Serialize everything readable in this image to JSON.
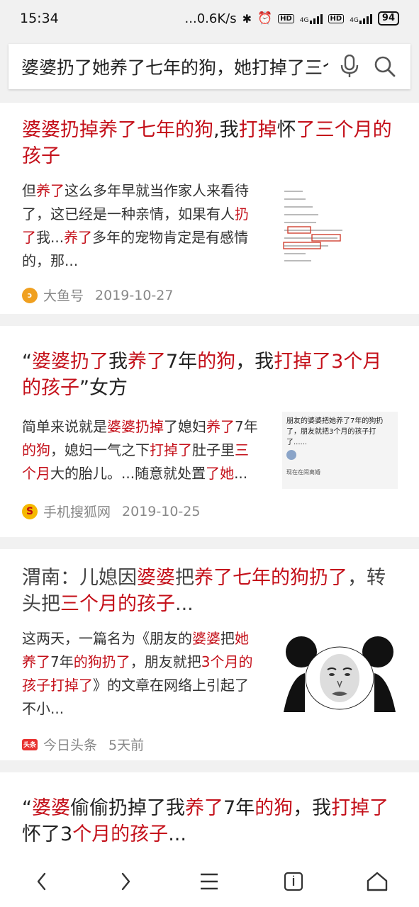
{
  "status": {
    "time": "15:34",
    "net_speed": "...0.6K/s",
    "battery": "94",
    "hd1": "HD",
    "hd2": "HD",
    "net1": "4G",
    "net2": "4G"
  },
  "search": {
    "query": "婆婆扔了她养了七年的狗，她打掉了三个"
  },
  "results": [
    {
      "title_parts": [
        {
          "t": "婆婆扔掉养了七年的狗",
          "h": true
        },
        {
          "t": ",我",
          "h": false
        },
        {
          "t": "打掉",
          "h": true
        },
        {
          "t": "怀",
          "h": false
        },
        {
          "t": "了三个月的",
          "h": true
        },
        {
          "t": "孩子",
          "h": true
        }
      ],
      "snippet_lines": [
        [
          {
            "t": "但",
            "h": false
          },
          {
            "t": "养了",
            "h": true
          },
          {
            "t": "这么多年早就当作家人来看待",
            "h": false
          }
        ],
        [
          {
            "t": "了，这已经是一种亲情，如果有人",
            "h": false
          },
          {
            "t": "扔",
            "h": true
          }
        ],
        [
          {
            "t": "了",
            "h": true
          },
          {
            "t": "我...",
            "h": false
          },
          {
            "t": "养了",
            "h": true
          },
          {
            "t": "多年的宠物肯定是有感情",
            "h": false
          }
        ],
        [
          {
            "t": "的，那...",
            "h": false
          }
        ]
      ],
      "source": "大鱼号",
      "date": "2019-10-27",
      "source_icon_color": "#f0a020"
    },
    {
      "title_parts": [
        {
          "t": "“",
          "h": false
        },
        {
          "t": "婆婆扔了",
          "h": true
        },
        {
          "t": "我",
          "h": false
        },
        {
          "t": "养了",
          "h": true
        },
        {
          "t": "7年",
          "h": false
        },
        {
          "t": "的狗",
          "h": true
        },
        {
          "t": "，我",
          "h": false
        },
        {
          "t": "打掉了3个月的",
          "h": true
        },
        {
          "t": "孩子",
          "h": true
        },
        {
          "t": "”女方",
          "h": false
        }
      ],
      "snippet_lines": [
        [
          {
            "t": "简单来说就是",
            "h": false
          },
          {
            "t": "婆婆扔掉",
            "h": true
          },
          {
            "t": "了媳妇",
            "h": false
          },
          {
            "t": "养了",
            "h": true
          },
          {
            "t": "7年",
            "h": false
          }
        ],
        [
          {
            "t": "的狗",
            "h": true
          },
          {
            "t": "，媳妇一气之下",
            "h": false
          },
          {
            "t": "打掉了",
            "h": true
          },
          {
            "t": "肚子里",
            "h": false
          },
          {
            "t": "三",
            "h": true
          }
        ],
        [
          {
            "t": "个月",
            "h": true
          },
          {
            "t": "大的胎儿。...随意就处置",
            "h": false
          },
          {
            "t": "了她",
            "h": true
          },
          {
            "t": "...",
            "h": false
          }
        ]
      ],
      "thumb_caption": "朋友的婆婆把她养了7年的狗扔了，朋友就把3个月的孩子打了......",
      "thumb_line": "现在在闹离婚",
      "source": "手机搜狐网",
      "date": "2019-10-25",
      "source_icon_color": "#f5b800"
    },
    {
      "title_parts": [
        {
          "t": "渭南：儿媳因",
          "h": false
        },
        {
          "t": "婆婆",
          "h": true
        },
        {
          "t": "把",
          "h": false
        },
        {
          "t": "养了七年的狗扔了",
          "h": true
        },
        {
          "t": "，转头把",
          "h": false
        },
        {
          "t": "三个月的孩子",
          "h": true
        },
        {
          "t": "...",
          "h": false
        }
      ],
      "snippet_lines": [
        [
          {
            "t": "这两天，一篇名为《朋友的",
            "h": false
          },
          {
            "t": "婆婆",
            "h": true
          },
          {
            "t": "把",
            "h": false
          },
          {
            "t": "她",
            "h": true
          }
        ],
        [
          {
            "t": "养了",
            "h": true
          },
          {
            "t": "7年",
            "h": false
          },
          {
            "t": "的狗扔了",
            "h": true
          },
          {
            "t": "，朋友就把",
            "h": false
          },
          {
            "t": "3个月的",
            "h": true
          }
        ],
        [
          {
            "t": "孩子打掉了",
            "h": true
          },
          {
            "t": "》的文章在网络上引起了",
            "h": false
          }
        ],
        [
          {
            "t": "不小...",
            "h": false
          }
        ]
      ],
      "source": "今日头条",
      "date": "5天前",
      "source_icon_color": "#e8312f",
      "source_icon_text": "头条"
    },
    {
      "title_parts": [
        {
          "t": "“",
          "h": false
        },
        {
          "t": "婆婆",
          "h": true
        },
        {
          "t": "偷偷扔掉了我",
          "h": false
        },
        {
          "t": "养了",
          "h": true
        },
        {
          "t": "7年",
          "h": false
        },
        {
          "t": "的狗",
          "h": true
        },
        {
          "t": "，我",
          "h": false
        },
        {
          "t": "打掉了",
          "h": true
        },
        {
          "t": "怀了3",
          "h": false
        },
        {
          "t": "个月的孩子",
          "h": true
        },
        {
          "t": "...",
          "h": false
        }
      ]
    }
  ],
  "colors": {
    "highlight": "#c4101a",
    "background": "#f1f1f1"
  },
  "icons": {
    "mic": "microphone-icon",
    "search": "search-icon",
    "back": "chevron-left-icon",
    "forward": "chevron-right-icon",
    "menu": "menu-icon",
    "tabs": "tabs-icon",
    "home": "home-icon"
  }
}
